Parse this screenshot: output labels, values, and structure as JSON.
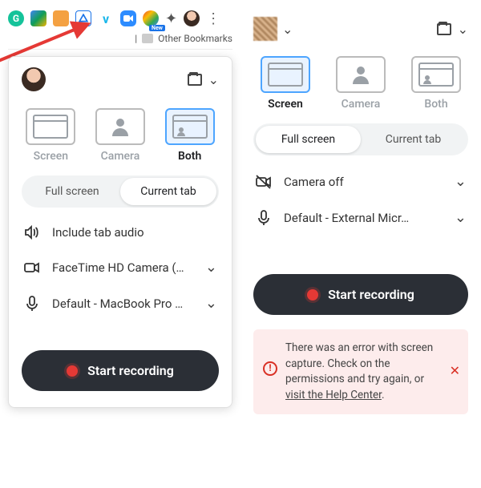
{
  "toolbar": {
    "new_badge": "New",
    "bookmarks_label": "Other Bookmarks"
  },
  "left": {
    "modes": {
      "screen": "Screen",
      "camera": "Camera",
      "both": "Both"
    },
    "seg": {
      "full": "Full screen",
      "tab": "Current tab"
    },
    "opts": {
      "audio": "Include tab audio",
      "camera_sel": "FaceTime HD Camera (…",
      "mic_sel": "Default - MacBook Pro …"
    },
    "record": "Start recording"
  },
  "right": {
    "modes": {
      "screen": "Screen",
      "camera": "Camera",
      "both": "Both"
    },
    "seg": {
      "full": "Full screen",
      "tab": "Current tab"
    },
    "opts": {
      "camera_off": "Camera off",
      "mic_sel": "Default - External Micr…"
    },
    "record": "Start recording",
    "error": {
      "text_a": "There was an error with screen capture. Check on the permissions and try again, or ",
      "link": "visit the Help Center",
      "text_b": "."
    }
  }
}
